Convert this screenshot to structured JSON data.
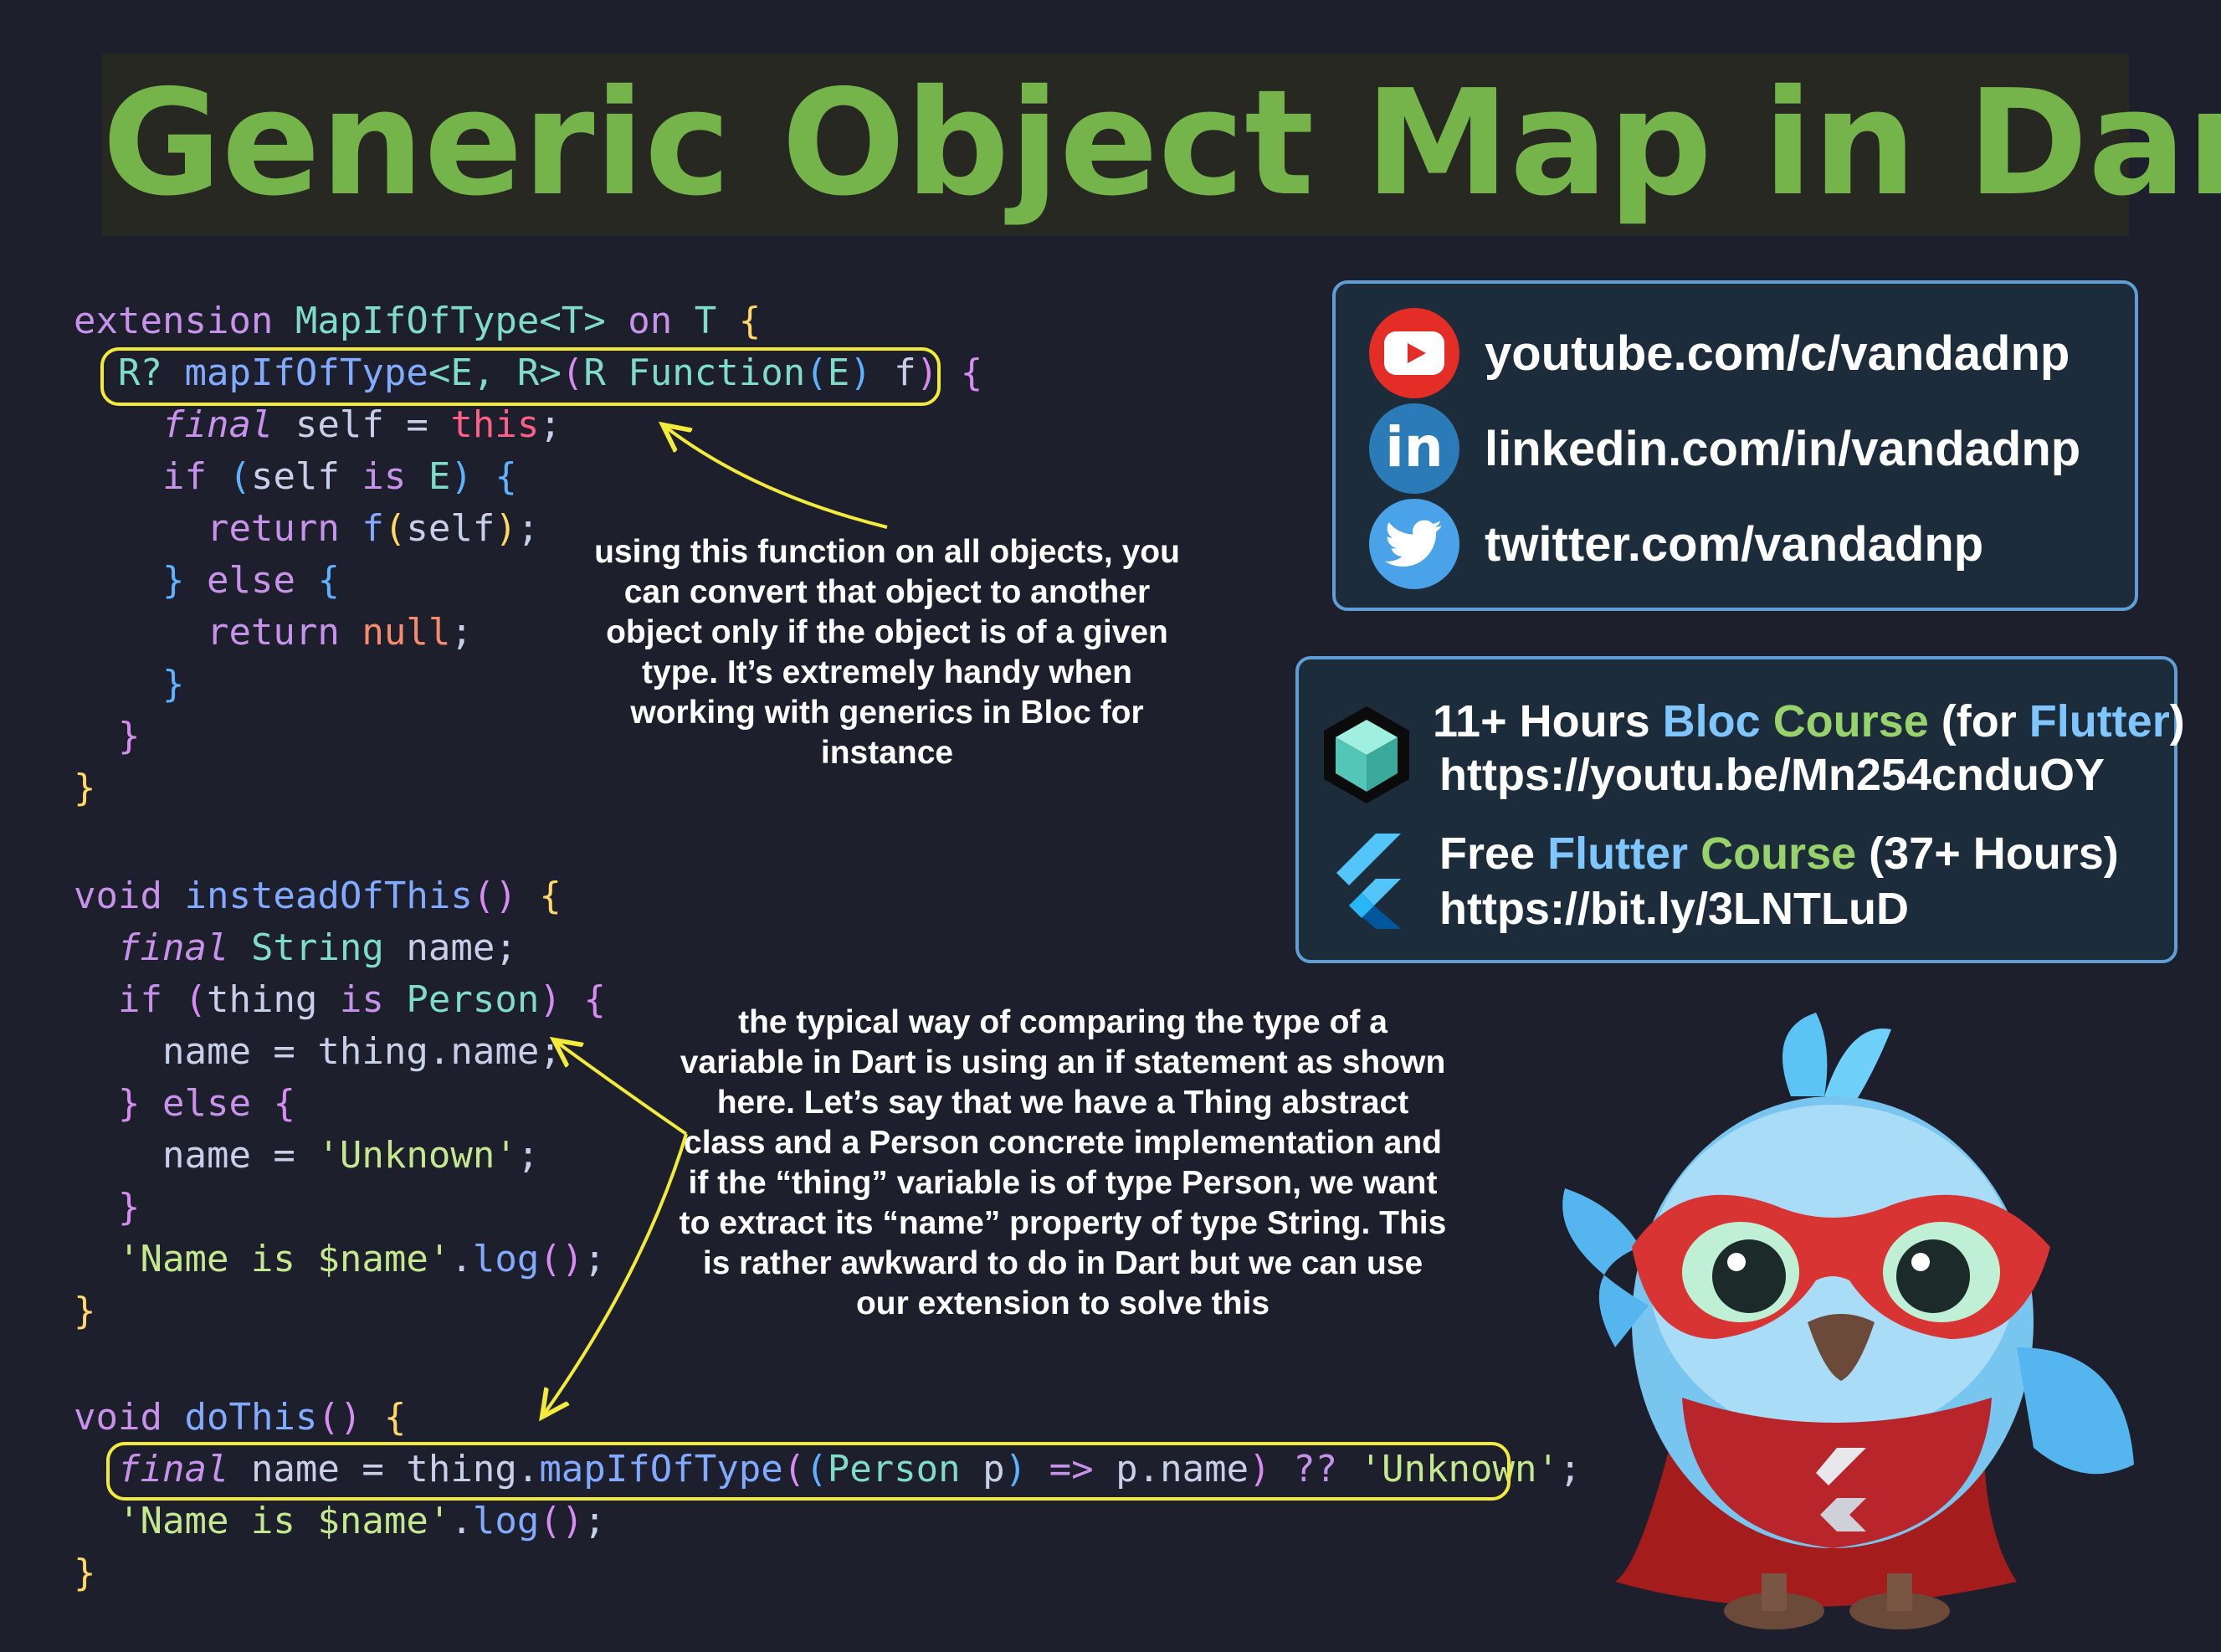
{
  "title": "Generic Object Map in Dart",
  "code": {
    "extension": [
      "extension MapIfOfType<T> on T {",
      "R? mapIfOfType<E, R>(R Function(E) f) {",
      "final self = this;",
      "if (self is E) {",
      "return f(self);",
      "} else {",
      "return null;",
      "}",
      "}",
      "}"
    ],
    "instead_of_this": [
      "void insteadOfThis() {",
      "final String name;",
      "if (thing is Person) {",
      "name = thing.name;",
      "} else {",
      "name = 'Unknown';",
      "}",
      "'Name is $name'.log();",
      "}"
    ],
    "do_this": [
      "void doThis() {",
      "final name = thing.mapIfOfType((Person p) => p.name) ?? 'Unknown';",
      "'Name is $name'.log();",
      "}"
    ]
  },
  "notes": {
    "function_note": "using this function on all objects, you can convert that object to another object only if the object is of a given type. It’s extremely handy when working with generics in Bloc for instance",
    "typical_way_note": "the typical way of comparing the type of a variable in Dart is using an if statement as shown here. Let’s say that we have a Thing abstract class and a Person concrete implementation and if the “thing” variable is of type Person, we want to extract its “name” property of type String. This is rather awkward to do in Dart but we can use our extension to solve this"
  },
  "social": {
    "youtube": "youtube.com/c/vandadnp",
    "linkedin": "linkedin.com/in/vandadnp",
    "linkedin_glyph": "in",
    "twitter": "twitter.com/vandadnp"
  },
  "courses": {
    "bloc": {
      "part1": "11+ Hours ",
      "part2": "Bloc",
      "part3": " ",
      "part4": "Course",
      "part5": " (for ",
      "part6": "Flutter",
      "part7": ")",
      "url": "https://youtu.be/Mn254cnduOY"
    },
    "flutter": {
      "part1": "Free ",
      "part2": "Flutter",
      "part3": " ",
      "part4": "Course",
      "part5": " (37+ Hours)",
      "url": "https://bit.ly/3LNTLuD"
    }
  },
  "colors": {
    "background": "#1e1f2d",
    "title_green": "#74b44a",
    "highlight_yellow": "#f2eb3a",
    "panel_border": "#5f9fd6",
    "youtube_red": "#e52d27",
    "linkedin_blue": "#2b7bb9",
    "twitter_blue": "#4aa3e8"
  }
}
